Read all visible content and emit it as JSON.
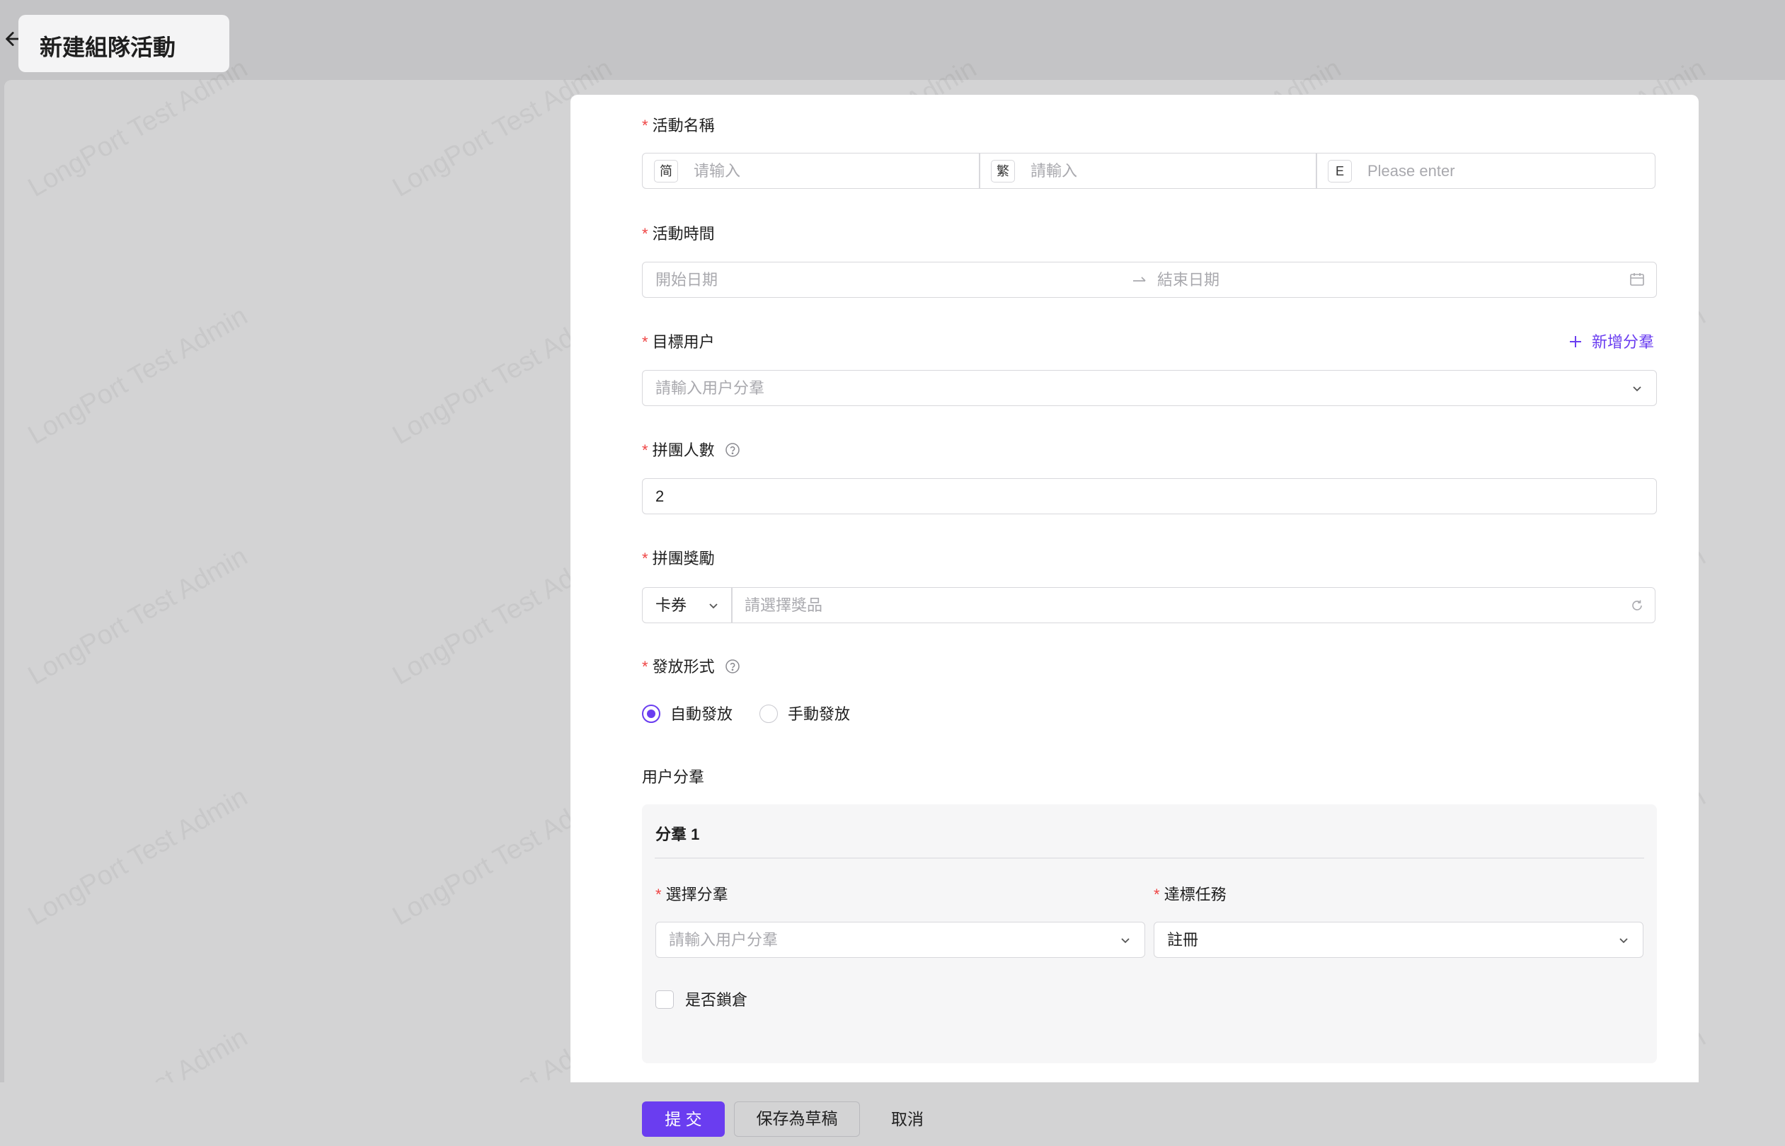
{
  "header": {
    "title": "新建組隊活動",
    "back_icon": "arrow-left-icon"
  },
  "form": {
    "activity_name": {
      "label": "活動名稱",
      "fields": [
        {
          "tag": "简",
          "placeholder": "请输入"
        },
        {
          "tag": "繁",
          "placeholder": "請輸入"
        },
        {
          "tag": "E",
          "placeholder": "Please enter"
        }
      ]
    },
    "activity_time": {
      "label": "活動時間",
      "start_placeholder": "開始日期",
      "end_placeholder": "結束日期",
      "icon": "calendar-icon"
    },
    "target_users": {
      "label": "目標用户",
      "add_link": "新增分羣",
      "placeholder": "請輸入用户分羣"
    },
    "group_size": {
      "label": "拼團人數",
      "value": "2"
    },
    "group_reward": {
      "label": "拼團獎勵",
      "type_value": "卡券",
      "placeholder": "請選擇獎品"
    },
    "distribution": {
      "label": "發放形式",
      "options": [
        "自動發放",
        "手動發放"
      ],
      "selected": "自動發放"
    },
    "user_segments": {
      "label": "用户分羣",
      "segment": {
        "title": "分羣 1",
        "select_label": "選擇分羣",
        "select_placeholder": "請輸入用户分羣",
        "task_label": "達標任務",
        "task_value": "註冊",
        "lock_label": "是否鎖倉",
        "lock_checked": false
      }
    }
  },
  "footer": {
    "submit": "提 交",
    "save_draft": "保存為草稿",
    "cancel": "取消"
  },
  "watermark": "LongPort Test Admin",
  "colors": {
    "accent": "#6a3df0",
    "required": "#ef4444"
  }
}
